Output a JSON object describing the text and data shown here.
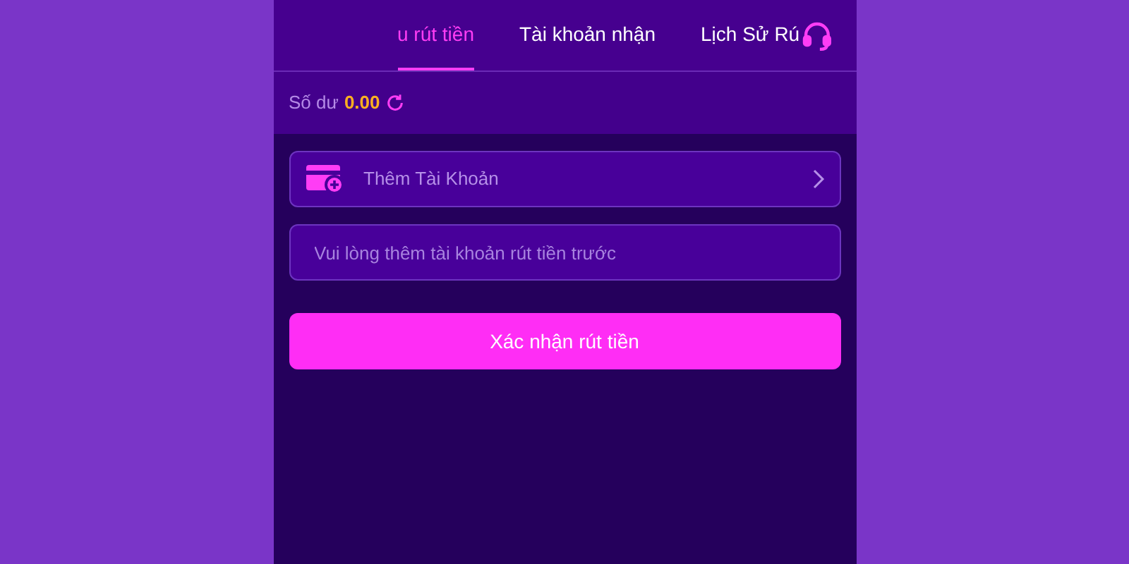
{
  "tabs": [
    {
      "label": "u rút tiền",
      "selected": true
    },
    {
      "label": "Tài khoản nhận",
      "selected": false
    },
    {
      "label": "Lịch Sử Rú",
      "selected": false
    }
  ],
  "balance": {
    "label": "Số dư",
    "value": "0.00"
  },
  "add_account": {
    "label": "Thêm Tài Khoản"
  },
  "account_field": {
    "placeholder": "Vui lòng thêm tài khoản rút tiền trước"
  },
  "confirm_button": "Xác nhận rút tiền"
}
